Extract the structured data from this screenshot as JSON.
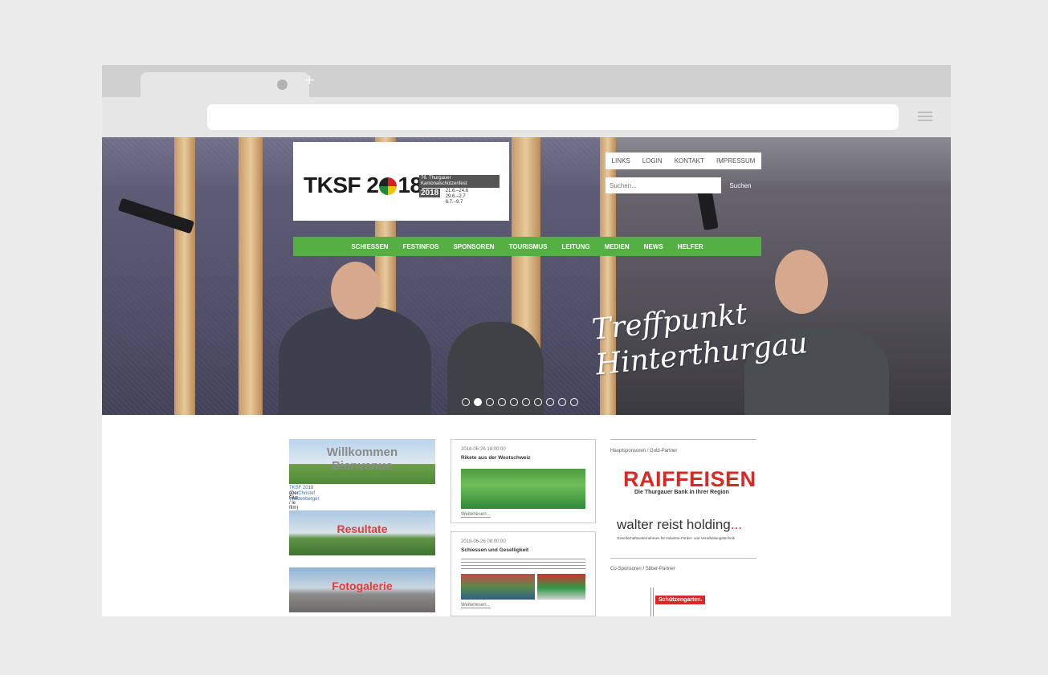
{
  "site": {
    "logo": {
      "text_a": "TKSF 2",
      "text_b": "18",
      "badge": "76. Thurgauer Kantonalschützenfest",
      "year": "2018",
      "dates": [
        "21.6.–24.6",
        "29.6.–2.7",
        "6.7.–9.7"
      ]
    },
    "top_links": [
      "LINKS",
      "LOGIN",
      "KONTAKT",
      "IMPRESSUM"
    ],
    "search": {
      "placeholder": "Suchen...",
      "button": "Suchen"
    },
    "nav": [
      "SCHIESSEN",
      "FESTINFOS",
      "SPONSOREN",
      "TOURISMUS",
      "LEITUNG",
      "MEDIEN",
      "NEWS",
      "HELFER"
    ],
    "tagline": [
      "Treffpunkt",
      "Hinterthurgau"
    ],
    "slider": {
      "count": 10,
      "active": 1
    }
  },
  "tiles": [
    {
      "label": "Willkommen\nBienvenue",
      "caption": "TKSF 2018 von Christof Waldenberger",
      "caption2": "(Der Film / le film)"
    },
    {
      "label": "Resultate"
    },
    {
      "label": "Fotogalerie"
    }
  ],
  "news": [
    {
      "timestamp": "2018-06-26 18:00:00",
      "title": "Rikete aus der Westschweiz",
      "more": "Weiterlesen..."
    },
    {
      "timestamp": "2018-06-26 08:00:00",
      "title": "Schiessen und Geselligkeit",
      "more": "Weiterlesen..."
    }
  ],
  "sidebar": {
    "heading_main": "Hauptsponsoren / Gold-Partner",
    "raiffeisen": "RAIFFEISEN",
    "raiffeisen_sub": "Die Thurgauer Bank in Ihrer Region",
    "reist": "walter reist holding",
    "reist_dots": "...",
    "reist_sub": "Gesellschaftsunternehmen für Industrie-Förder- und Verarbeitungstechnik",
    "heading_co": "Co-Sponsoren / Silber-Partner",
    "schuetz": "Schützengarten."
  },
  "colors": {
    "nav_green": "#55b043",
    "accent_red": "#d62a24"
  }
}
